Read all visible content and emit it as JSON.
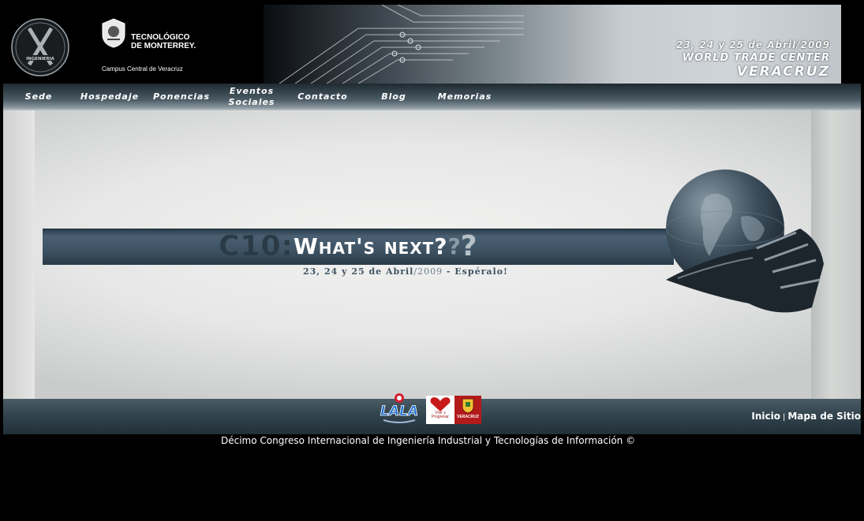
{
  "header": {
    "expo_logo_text": "INGENIERIA",
    "tec_name": "TECNOLÓGICO\nDE MONTERREY.",
    "campus": "Campus Central de Veracruz",
    "date": "23, 24 y 25 de Abril/2009",
    "venue": "WORLD TRADE CENTER",
    "city": "VERACRUZ"
  },
  "nav": {
    "items": [
      {
        "label": "Sede"
      },
      {
        "label": "Hospedaje"
      },
      {
        "label": "Ponencias"
      },
      {
        "label": "Eventos\nSociales"
      },
      {
        "label": "Contacto"
      },
      {
        "label": "Blog"
      },
      {
        "label": "Memorias"
      }
    ]
  },
  "hero": {
    "prefix": "C10:",
    "headline": "What's next?",
    "question_marks": "?",
    "question_marks_2": "?",
    "tagline_dates": "23, 24 y 25 de Abril",
    "tagline_year": "/2009",
    "tagline_end": " - Espéralo!"
  },
  "sponsors": {
    "lala": "LALA",
    "vivir_text": "Vivir y\nProgresar",
    "veracruz_text": "VERACRUZ"
  },
  "footer": {
    "links": [
      {
        "label": "Inicio"
      },
      {
        "label": "Mapa de Sitio"
      }
    ],
    "separator": "|",
    "copyright": "Décimo Congreso Internacional de Ingeniería Industrial y Tecnologías de Información ©"
  },
  "colors": {
    "background": "#000000",
    "nav_bar": "#3b4a53",
    "hero_bar": "#3d5263",
    "footer_bar": "#33444e"
  }
}
